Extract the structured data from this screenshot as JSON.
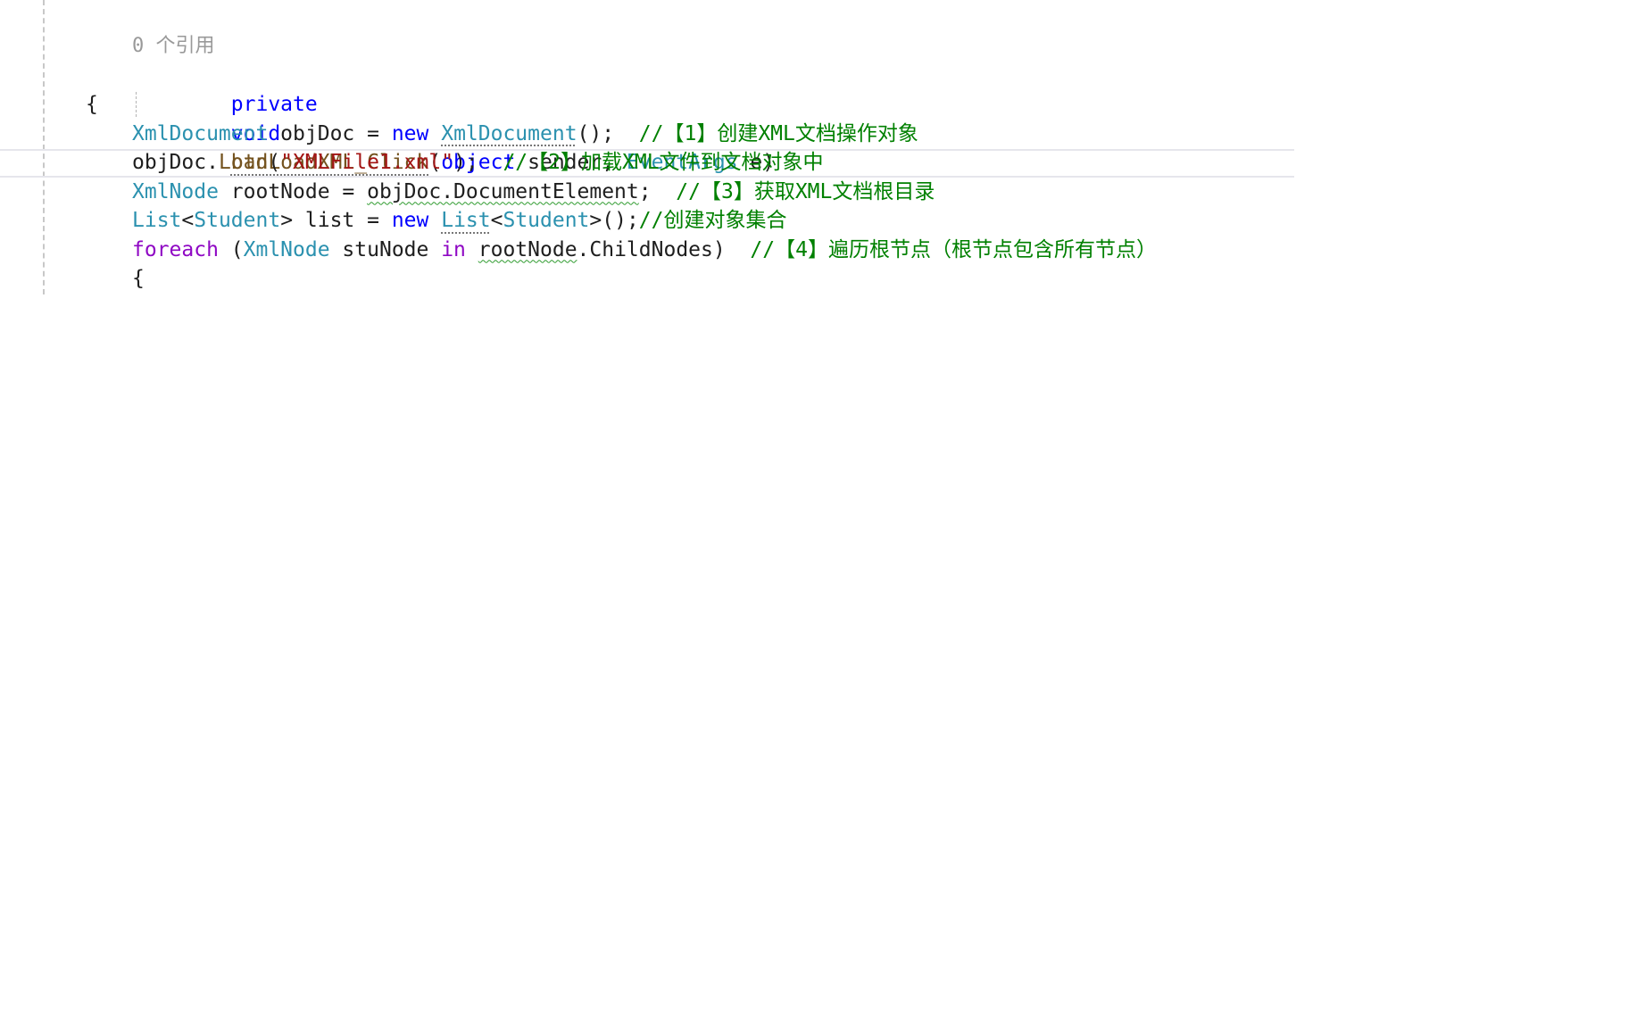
{
  "code_lens": {
    "references": "0 个引用"
  },
  "method_signature": {
    "modifier": "private",
    "return_type": "void",
    "name": "btnLoadXML_Click",
    "open_paren": "(",
    "param1_type": "object",
    "param1_name": " sender, ",
    "param2_type": "EventArgs",
    "param2_name": " e)"
  },
  "braces": {
    "method_open": "{",
    "loop_open": "{"
  },
  "line1": {
    "type": "XmlDocument",
    "var": " objDoc = ",
    "kw_new": "new",
    "space": " ",
    "ctor": "XmlDocument",
    "tail": "();  ",
    "comment": "//【1】创建XML文档操作对象"
  },
  "line2": {
    "obj": "objDoc.",
    "method": "Load",
    "open": "(",
    "string": "\"XMLFile1.xml\"",
    "tail": ");  ",
    "comment": "//【2】加载XML文件到文档对象中"
  },
  "line3": {
    "type": "XmlNode",
    "var": " rootNode = ",
    "expr": "objDoc.DocumentElement",
    "tail": ";  ",
    "comment": "//【3】获取XML文档根目录"
  },
  "line4": {
    "type": "List",
    "lt": "<",
    "generic": "Student",
    "gt_var": "> list = ",
    "kw_new": "new",
    "space": " ",
    "ctor": "List",
    "lt2": "<",
    "generic2": "Student",
    "tail": ">();",
    "comment": "//创建对象集合"
  },
  "line5": {
    "kw_foreach": "foreach",
    "open": " (",
    "type": "XmlNode",
    "var": " stuNode ",
    "kw_in": "in",
    "space": " ",
    "collection": "rootNode",
    "member": ".ChildNodes)  ",
    "comment": "//【4】遍历根节点（根节点包含所有节点）"
  },
  "colors": {
    "keyword": "#0000ff",
    "control_keyword": "#8f08c4",
    "type": "#2b91af",
    "method": "#74531f",
    "string": "#a31515",
    "comment": "#008000",
    "code_lens": "#999999"
  }
}
